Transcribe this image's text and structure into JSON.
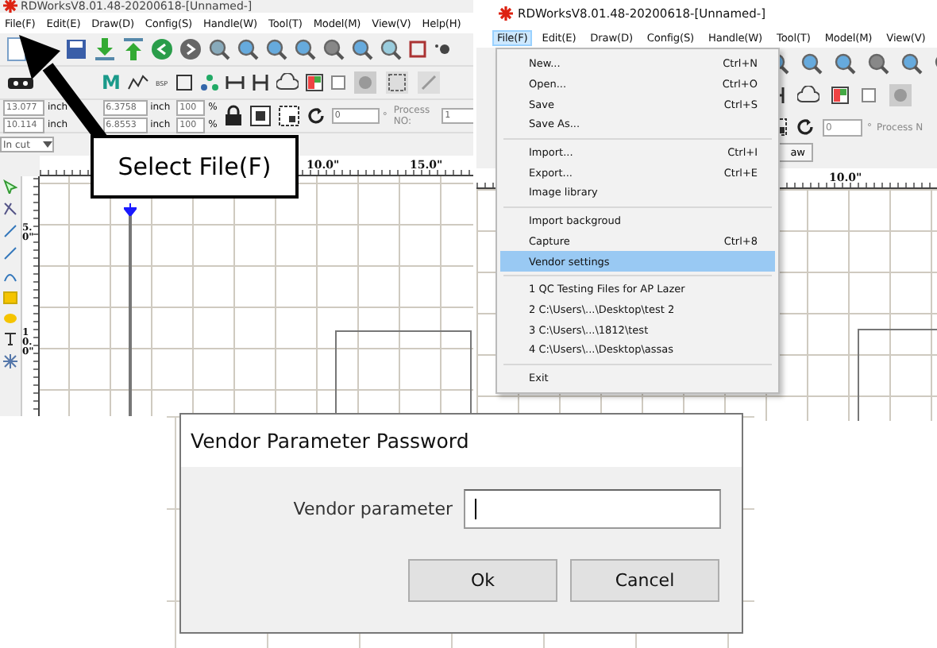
{
  "left_screenshot": {
    "title": "RDWorksV8.01.48-20200618-[Unnamed-]",
    "menu": [
      {
        "label": "File(F)",
        "selected": false
      },
      {
        "label": "Edit(E)",
        "selected": false
      },
      {
        "label": "Draw(D)",
        "selected": false
      },
      {
        "label": "Config(S)",
        "selected": false
      },
      {
        "label": "Handle(W)",
        "selected": false
      },
      {
        "label": "Tool(T)",
        "selected": false
      },
      {
        "label": "Model(M)",
        "selected": false
      },
      {
        "label": "View(V)",
        "selected": false
      },
      {
        "label": "Help(H)",
        "selected": false
      }
    ],
    "toolbar_letter": "M",
    "toolbar_tag": "BSP",
    "coordinate_fields": [
      {
        "value": "13.077",
        "unit": "inch"
      },
      {
        "value": "10.114",
        "unit": "inch"
      }
    ],
    "size_fields": [
      {
        "value": "6.3758",
        "unit": "inch"
      },
      {
        "value": "6.8553",
        "unit": "inch"
      }
    ],
    "scale_fields": [
      {
        "value": "100",
        "unit": "%"
      },
      {
        "value": "100",
        "unit": "%"
      }
    ],
    "rotation": {
      "value": "0",
      "unit": "°"
    },
    "process": {
      "label": "Process NO:",
      "value": "1"
    },
    "layer_dropdown": "In cut",
    "ruler_labels": [
      "10.0\"",
      "15.0\""
    ],
    "vertical_ruler_labels": [
      "5.0\"",
      "10.0\""
    ]
  },
  "callout": {
    "text": "Select File(F)"
  },
  "right_screenshot": {
    "title": "RDWorksV8.01.48-20200618-[Unnamed-]",
    "menu": [
      {
        "label": "File(F)",
        "selected": true
      },
      {
        "label": "Edit(E)",
        "selected": false
      },
      {
        "label": "Draw(D)",
        "selected": false
      },
      {
        "label": "Config(S)",
        "selected": false
      },
      {
        "label": "Handle(W)",
        "selected": false
      },
      {
        "label": "Tool(T)",
        "selected": false
      },
      {
        "label": "Model(M)",
        "selected": false
      },
      {
        "label": "View(V)",
        "selected": false
      }
    ],
    "rotation": {
      "value": "0",
      "unit": "°"
    },
    "process_label": "Process N",
    "partial_button": "aw",
    "ruler_labels": [
      "10.0\""
    ],
    "file_menu": [
      {
        "kind": "item",
        "label": "New...",
        "shortcut": "Ctrl+N",
        "selected": false
      },
      {
        "kind": "item",
        "label": "Open...",
        "shortcut": "Ctrl+O",
        "selected": false
      },
      {
        "kind": "item",
        "label": "Save",
        "shortcut": "Ctrl+S",
        "selected": false
      },
      {
        "kind": "item",
        "label": "Save As...",
        "selected": false
      },
      {
        "kind": "separator"
      },
      {
        "kind": "item",
        "label": "Import...",
        "shortcut": "Ctrl+I",
        "selected": false
      },
      {
        "kind": "item",
        "label": "Export...",
        "shortcut": "Ctrl+E",
        "selected": false
      },
      {
        "kind": "item",
        "label": "Image library",
        "selected": false
      },
      {
        "kind": "separator"
      },
      {
        "kind": "item",
        "label": "Import backgroud",
        "selected": false
      },
      {
        "kind": "item",
        "label": "Capture",
        "shortcut": "Ctrl+8",
        "selected": false
      },
      {
        "kind": "item",
        "label": "Vendor settings",
        "selected": true
      },
      {
        "kind": "separator"
      },
      {
        "kind": "item",
        "label": "1 QC Testing Files for AP Lazer",
        "selected": false
      },
      {
        "kind": "item",
        "label": "2 C:\\Users\\...\\Desktop\\test 2",
        "selected": false
      },
      {
        "kind": "item",
        "label": "3 C:\\Users\\...\\1812\\test",
        "selected": false
      },
      {
        "kind": "item",
        "label": "4 C:\\Users\\...\\Desktop\\assas",
        "selected": false
      },
      {
        "kind": "separator"
      },
      {
        "kind": "item",
        "label": "Exit",
        "selected": false
      }
    ]
  },
  "dialog": {
    "title": "Vendor Parameter Password",
    "field_label": "Vendor parameter",
    "buttons": [
      "Ok",
      "Cancel"
    ]
  }
}
